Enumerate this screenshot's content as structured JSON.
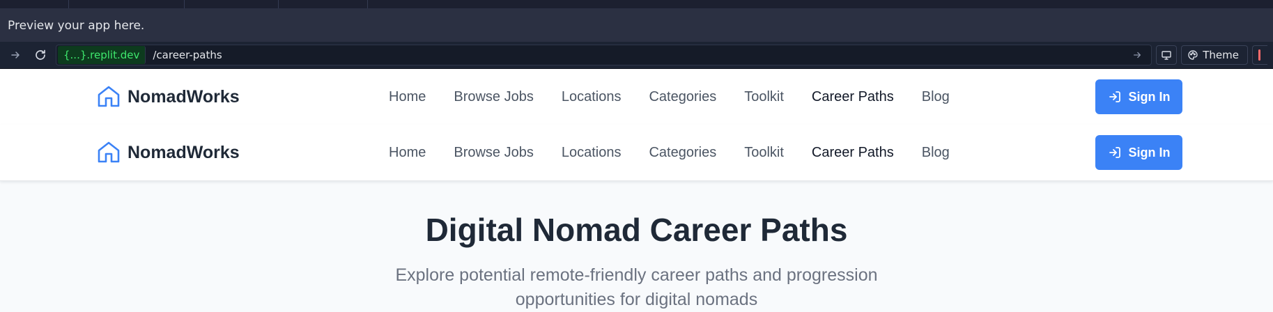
{
  "browser": {
    "preview_message": "Preview your app here.",
    "url": {
      "domain": "{...}.replit.dev",
      "path": "/career-paths"
    },
    "theme_label": "Theme"
  },
  "nav": {
    "brand": "NomadWorks",
    "links": [
      "Home",
      "Browse Jobs",
      "Locations",
      "Categories",
      "Toolkit",
      "Career Paths",
      "Blog"
    ],
    "active_link": "Career Paths",
    "sign_in": "Sign In"
  },
  "hero": {
    "title": "Digital Nomad Career Paths",
    "subtitle": "Explore potential remote-friendly career paths and progression opportunities for digital nomads"
  },
  "colors": {
    "primary": "#3b82f6",
    "heading": "#1f2937",
    "nav_text": "#4b5563",
    "replit_domain": "#3ee86d"
  }
}
